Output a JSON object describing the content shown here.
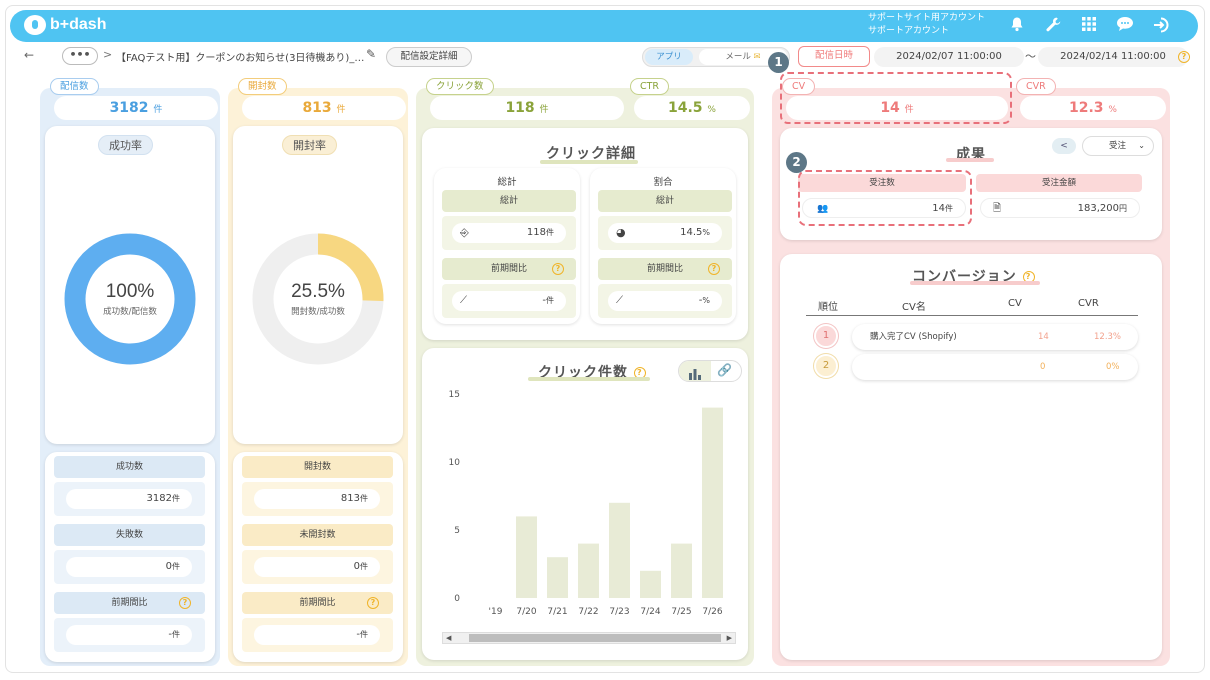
{
  "header": {
    "logo_text": "b+dash",
    "account_line1": "サポートサイト用アカウント",
    "account_line2": "サポートアカウント"
  },
  "subbar": {
    "back_icon": "←",
    "more_label": "•••",
    "separator": ">",
    "breadcrumb": "【FAQテスト用】クーポンのお知らせ(3日待機あり)_…",
    "edit_icon": "✎",
    "detail_button": "配信設定詳細",
    "toggle_app": "アプリ",
    "toggle_mail": "メール",
    "send_date_tab": "配信日時",
    "date_from": "2024/02/07 11:00:00",
    "date_tilde": "〜",
    "date_to": "2024/02/14 11:00:00"
  },
  "delivery": {
    "tag": "配信数",
    "value": "3182",
    "unit": "件",
    "panel_title": "成功率",
    "donut_value": "100%",
    "donut_caption": "成功数/配信数",
    "donut_fraction": 1.0,
    "rows": [
      {
        "label": "成功数",
        "value": "3182",
        "unit": "件"
      },
      {
        "label": "失敗数",
        "value": "0",
        "unit": "件"
      },
      {
        "label": "前期間比",
        "value": "-",
        "unit": "件"
      }
    ]
  },
  "opened": {
    "tag": "開封数",
    "value": "813",
    "unit": "件",
    "panel_title": "開封率",
    "donut_value": "25.5%",
    "donut_caption": "開封数/成功数",
    "donut_fraction": 0.255,
    "rows": [
      {
        "label": "開封数",
        "value": "813",
        "unit": "件"
      },
      {
        "label": "未開封数",
        "value": "0",
        "unit": "件"
      },
      {
        "label": "前期間比",
        "value": "-",
        "unit": "件"
      }
    ]
  },
  "clicks": {
    "tag": "クリック数",
    "value": "118",
    "unit": "件",
    "ctr_tag": "CTR",
    "ctr_value": "14.5",
    "ctr_unit": "%",
    "detail_title": "クリック詳細",
    "total_head": "総計",
    "ratio_head": "割合",
    "total_label": "総計",
    "total_value": "118",
    "total_unit": "件",
    "ratio_label": "総計",
    "ratio_value": "14.5",
    "ratio_unit": "%",
    "prev_label": "前期間比",
    "prev_total_value": "-",
    "prev_total_unit": "件",
    "prev_ratio_value": "-",
    "prev_ratio_unit": "%",
    "count_title": "クリック件数"
  },
  "conversion": {
    "cv_tag": "CV",
    "cv_value": "14",
    "cv_unit": "件",
    "cvr_tag": "CVR",
    "cvr_value": "12.3",
    "cvr_unit": "%",
    "result_title": "成果",
    "result_select": "受注",
    "orders_label": "受注数",
    "orders_value": "14",
    "orders_unit": "件",
    "amount_label": "受注金額",
    "amount_value": "183,200",
    "amount_unit": "円",
    "conv_title": "コンバージョン",
    "table_headers": [
      "順位",
      "CV名",
      "CV",
      "CVR"
    ],
    "table_rows": [
      {
        "rank": "1",
        "name": "購入完了CV (Shopify)",
        "cv": "14",
        "cvr": "12.3%"
      },
      {
        "rank": "2",
        "name": "",
        "cv": "0",
        "cvr": "0%"
      }
    ]
  },
  "annotations": {
    "badge1": "1",
    "badge2": "2"
  },
  "colors": {
    "header": "#4fc4f2",
    "delivery": "#4a9fe0",
    "opened": "#e9a93a",
    "clicks": "#8aa33a",
    "conversion": "#ee7b7b",
    "bar": "#e8ebd6"
  },
  "chart_data": {
    "type": "bar",
    "categories": [
      "'19",
      "7/20",
      "7/21",
      "7/22",
      "7/23",
      "7/24",
      "7/25",
      "7/26"
    ],
    "values": [
      0,
      6,
      3,
      4,
      7,
      2,
      4,
      14
    ],
    "ylim": [
      0,
      15
    ],
    "yticks": [
      0,
      5,
      10,
      15
    ],
    "grid": false
  }
}
